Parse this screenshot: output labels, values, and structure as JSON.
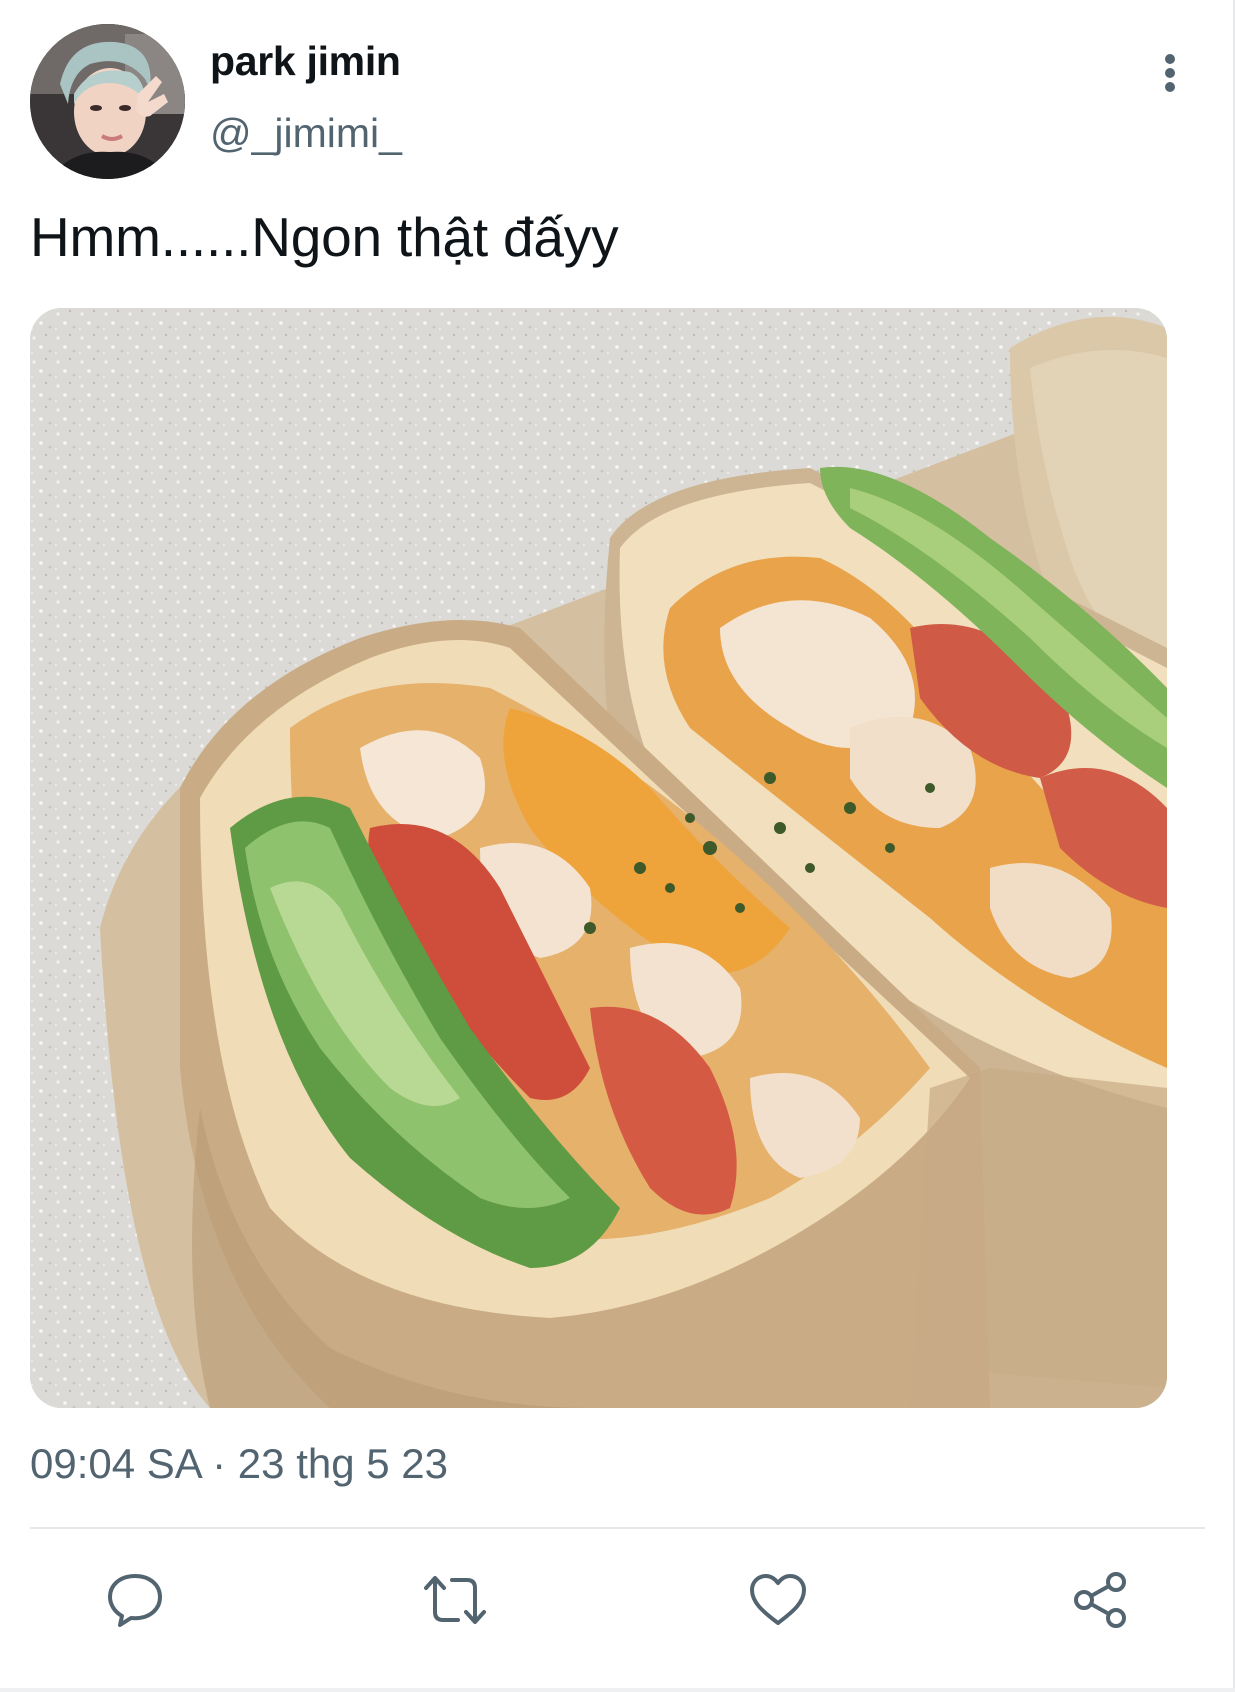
{
  "user": {
    "display_name": "park jimin",
    "handle": "@_jimimi_"
  },
  "tweet": {
    "text": "Hmm......Ngon thật đấyy",
    "timestamp": "09:04 SA · 23 thg 5 23"
  },
  "icons": {
    "more": "more-vertical-icon",
    "reply": "reply-icon",
    "retweet": "retweet-icon",
    "like": "heart-icon",
    "share": "share-icon"
  },
  "colors": {
    "text_primary": "#0f1419",
    "text_secondary": "#536471",
    "divider": "#e4e8ea"
  }
}
